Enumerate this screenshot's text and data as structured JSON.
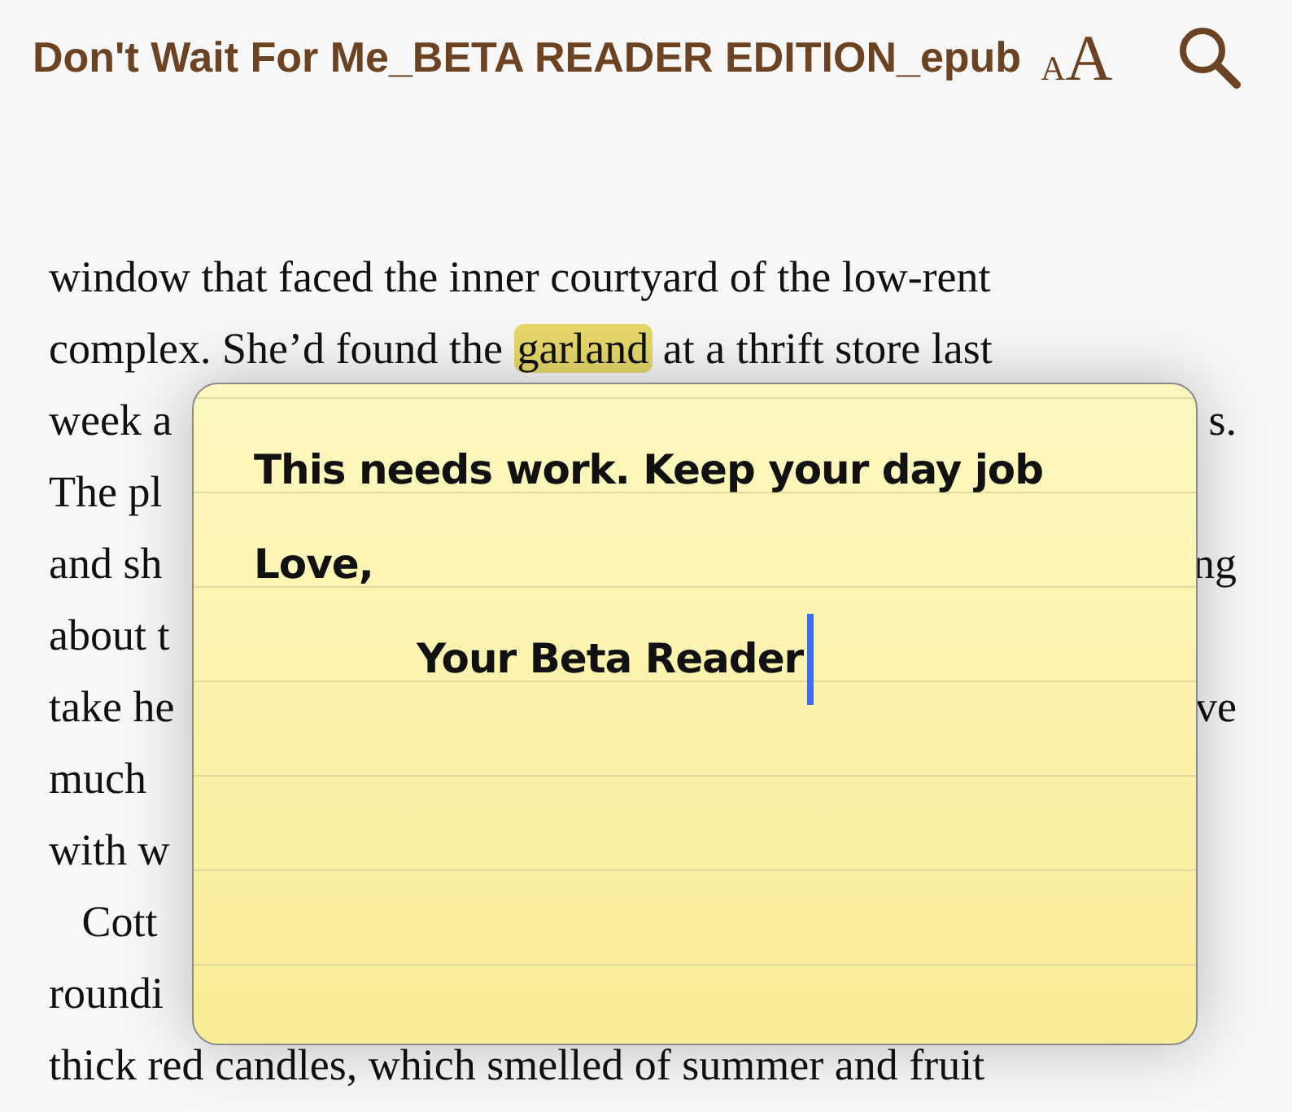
{
  "header": {
    "title": "Don't Wait For Me_BETA READER EDITION_epub",
    "font_size_button": {
      "small": "A",
      "large": "A"
    }
  },
  "book_lines": [
    {
      "left": [
        {
          "text": "window that faced the inner courtyard of the low-rent",
          "highlighted": false
        }
      ]
    },
    {
      "left": [
        {
          "text": "complex. She’d found the ",
          "highlighted": false
        },
        {
          "text": "garland",
          "highlighted": true
        },
        {
          "text": " at a thrift store last",
          "highlighted": false
        }
      ]
    },
    {
      "left": [
        {
          "text": "week a",
          "highlighted": false
        }
      ],
      "right": "s."
    },
    {
      "left": [
        {
          "text": "The pl",
          "highlighted": false
        }
      ]
    },
    {
      "left": [
        {
          "text": "and sh",
          "highlighted": false
        }
      ],
      "right": "ng"
    },
    {
      "left": [
        {
          "text": "about t",
          "highlighted": false
        }
      ]
    },
    {
      "left": [
        {
          "text": "take he",
          "highlighted": false
        }
      ],
      "right": "ve"
    },
    {
      "left": [
        {
          "text": "much",
          "highlighted": false
        }
      ]
    },
    {
      "left": [
        {
          "text": "with w",
          "highlighted": false
        }
      ]
    },
    {
      "left": [
        {
          "text": "   Cott",
          "highlighted": false
        }
      ]
    },
    {
      "left": [
        {
          "text": "roundi",
          "highlighted": false
        }
      ]
    },
    {
      "left": [
        {
          "text": "thick red candles, which smelled of summer and fruit",
          "highlighted": false
        }
      ]
    }
  ],
  "note": {
    "lines": [
      {
        "kind": "body",
        "text": "This needs work. Keep your day job"
      },
      {
        "kind": "body",
        "text": "Love,"
      },
      {
        "kind": "signature",
        "text": "Your Beta Reader"
      }
    ]
  }
}
